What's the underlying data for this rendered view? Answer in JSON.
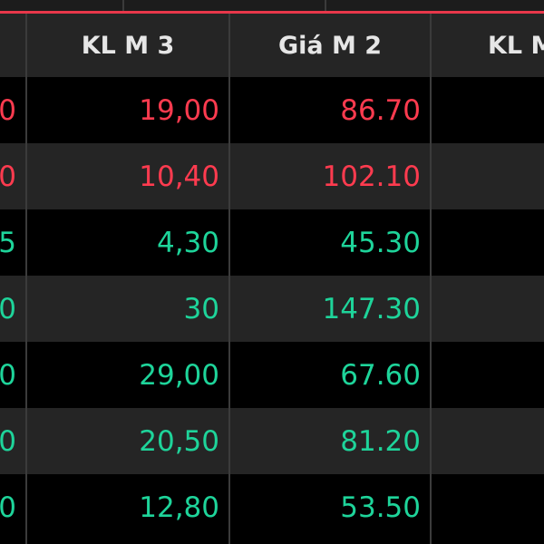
{
  "columns": [
    "",
    "KL M 3",
    "Giá M 2",
    "KL M"
  ],
  "colors": {
    "up": "#1ed49a",
    "down": "#ff3b4f",
    "accent": "#e8374a"
  },
  "rows": [
    {
      "c0": "0",
      "kl_m3": "19,00",
      "gia_m2": "86.70",
      "trend": "down"
    },
    {
      "c0": "0",
      "kl_m3": "10,40",
      "gia_m2": "102.10",
      "trend": "down"
    },
    {
      "c0": "5",
      "kl_m3": "4,30",
      "gia_m2": "45.30",
      "trend": "up"
    },
    {
      "c0": "0",
      "kl_m3": "30",
      "gia_m2": "147.30",
      "trend": "up"
    },
    {
      "c0": "0",
      "kl_m3": "29,00",
      "gia_m2": "67.60",
      "trend": "up"
    },
    {
      "c0": "0",
      "kl_m3": "20,50",
      "gia_m2": "81.20",
      "trend": "up"
    },
    {
      "c0": "0",
      "kl_m3": "12,80",
      "gia_m2": "53.50",
      "trend": "up"
    }
  ]
}
